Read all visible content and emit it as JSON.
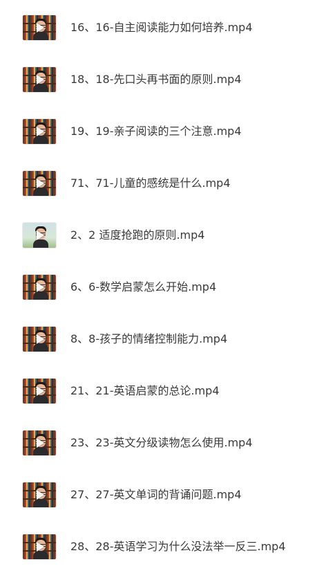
{
  "files": [
    {
      "name": "16、16-自主阅读能力如何培养.mp4",
      "thumb": "video-thumbnail"
    },
    {
      "name": "18、18-先口头再书面的原则.mp4",
      "thumb": "video-thumbnail"
    },
    {
      "name": "19、19-亲子阅读的三个注意.mp4",
      "thumb": "video-thumbnail"
    },
    {
      "name": "71、71-儿童的感统是什么.mp4",
      "thumb": "video-thumbnail"
    },
    {
      "name": "2、2 适度抢跑的原则.mp4",
      "thumb": "video-thumbnail-light"
    },
    {
      "name": "6、6-数学启蒙怎么开始.mp4",
      "thumb": "video-thumbnail"
    },
    {
      "name": "8、8-孩子的情绪控制能力.mp4",
      "thumb": "video-thumbnail"
    },
    {
      "name": "21、21-英语启蒙的总论.mp4",
      "thumb": "video-thumbnail"
    },
    {
      "name": "23、23-英文分级读物怎么使用.mp4",
      "thumb": "video-thumbnail"
    },
    {
      "name": "27、27-英文单词的背诵问题.mp4",
      "thumb": "video-thumbnail"
    },
    {
      "name": "28、28-英语学习为什么没法举一反三.mp4",
      "thumb": "video-thumbnail"
    }
  ],
  "icons": {
    "play": "play-icon"
  }
}
